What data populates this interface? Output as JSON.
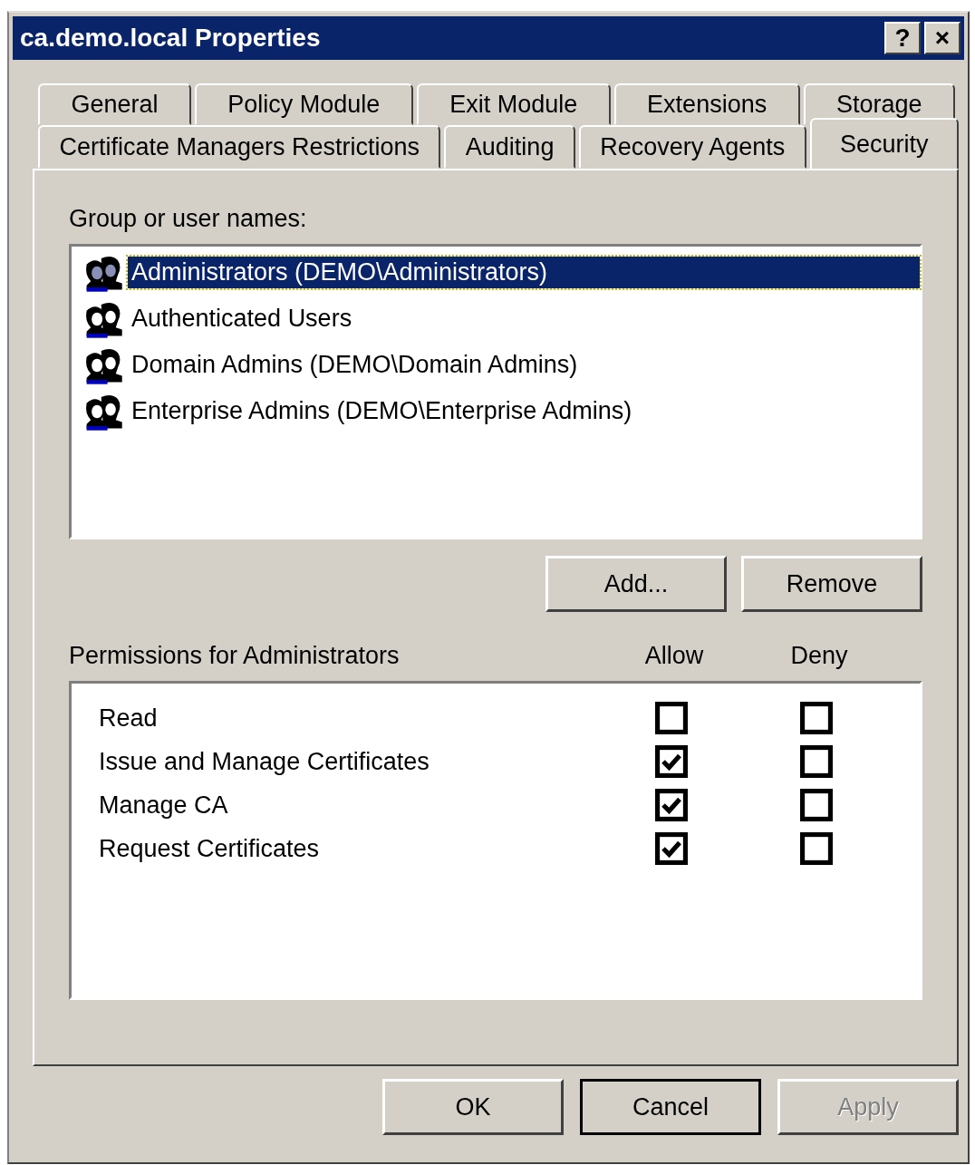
{
  "window": {
    "title": "ca.demo.local Properties",
    "title_buttons": [
      "?",
      "×"
    ]
  },
  "tab_rows": [
    [
      {
        "label": "General",
        "selected": false
      },
      {
        "label": "Policy Module",
        "selected": false
      },
      {
        "label": "Exit Module",
        "selected": false
      },
      {
        "label": "Extensions",
        "selected": false
      },
      {
        "label": "Storage",
        "selected": false
      }
    ],
    [
      {
        "label": "Certificate Managers Restrictions",
        "selected": false
      },
      {
        "label": "Auditing",
        "selected": false
      },
      {
        "label": "Recovery Agents",
        "selected": false
      },
      {
        "label": "Security",
        "selected": true
      }
    ]
  ],
  "group_label": "Group or user names:",
  "groups": [
    {
      "name": "Administrators (DEMO\\Administrators)",
      "selected": true
    },
    {
      "name": "Authenticated Users",
      "selected": false
    },
    {
      "name": "Domain Admins (DEMO\\Domain Admins)",
      "selected": false
    },
    {
      "name": "Enterprise Admins (DEMO\\Enterprise Admins)",
      "selected": false
    }
  ],
  "group_buttons": [
    {
      "label": "Add...",
      "disabled": false
    },
    {
      "label": "Remove",
      "disabled": false
    }
  ],
  "permissions": {
    "label": "Permissions for Administrators",
    "allow_header": "Allow",
    "deny_header": "Deny",
    "rows": [
      {
        "name": "Read",
        "allow": false,
        "deny": false
      },
      {
        "name": "Issue and Manage Certificates",
        "allow": true,
        "deny": false
      },
      {
        "name": "Manage CA",
        "allow": true,
        "deny": false
      },
      {
        "name": "Request Certificates",
        "allow": true,
        "deny": false
      }
    ]
  },
  "buttons": [
    {
      "label": "OK",
      "default": false,
      "disabled": false
    },
    {
      "label": "Cancel",
      "default": true,
      "disabled": false
    },
    {
      "label": "Apply",
      "default": false,
      "disabled": true
    }
  ]
}
